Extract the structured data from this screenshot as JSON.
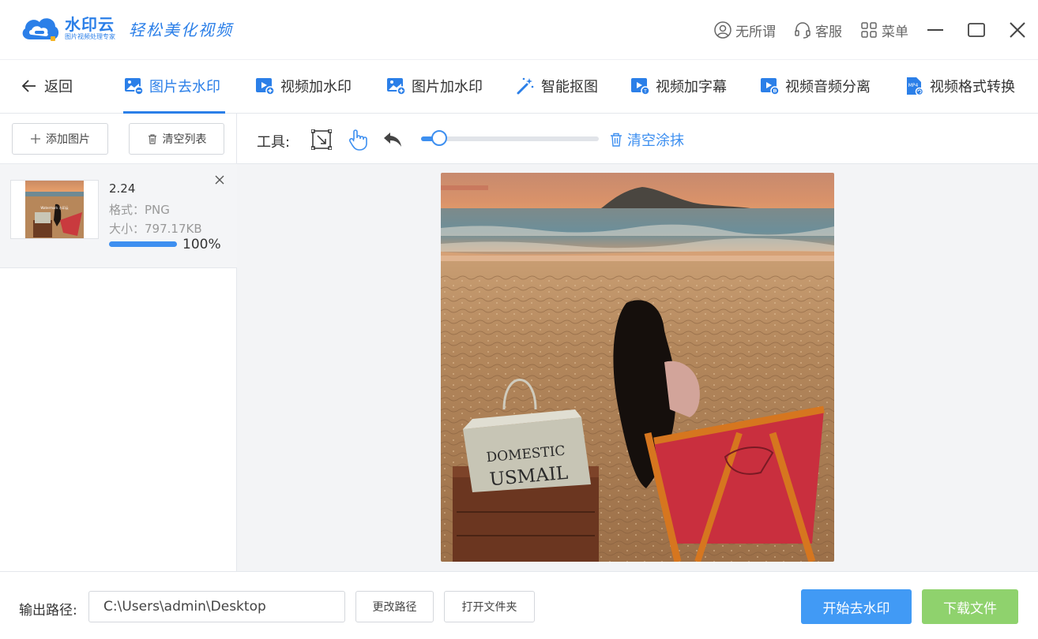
{
  "app": {
    "name": "水印云",
    "subtitle": "图片视频处理专家",
    "slogan": "轻松美化视频"
  },
  "topbar": {
    "user_label": "无所谓",
    "service_label": "客服",
    "menu_label": "菜单"
  },
  "nav": {
    "back_label": "返回",
    "tabs": [
      {
        "label": "图片去水印",
        "active": true
      },
      {
        "label": "视频加水印"
      },
      {
        "label": "图片加水印"
      },
      {
        "label": "智能抠图"
      },
      {
        "label": "视频加字幕"
      },
      {
        "label": "视频音频分离"
      },
      {
        "label": "视频格式转换"
      }
    ]
  },
  "left": {
    "add_label": "添加图片",
    "clear_label": "清空列表",
    "file": {
      "name": "2.24",
      "format": "格式：PNG",
      "size": "大小：797.17KB",
      "progress": 1.0,
      "progress_text": "100%"
    }
  },
  "toolbar": {
    "label": "工具:",
    "clear_label": "清空涂抹",
    "brush_level": 0.1
  },
  "photo": {
    "bag_line1": "DOMESTIC",
    "bag_line2": "USMAIL"
  },
  "bottom": {
    "output_label": "输出路径:",
    "output_path": "C:\\Users\\admin\\Desktop",
    "change_path": "更改路径",
    "open_folder": "打开文件夹",
    "start_label": "开始去水印",
    "download_label": "下载文件"
  },
  "colors": {
    "accent": "#2b7fe8",
    "primary_button": "#419af5",
    "download_button": "#8fd26d"
  }
}
